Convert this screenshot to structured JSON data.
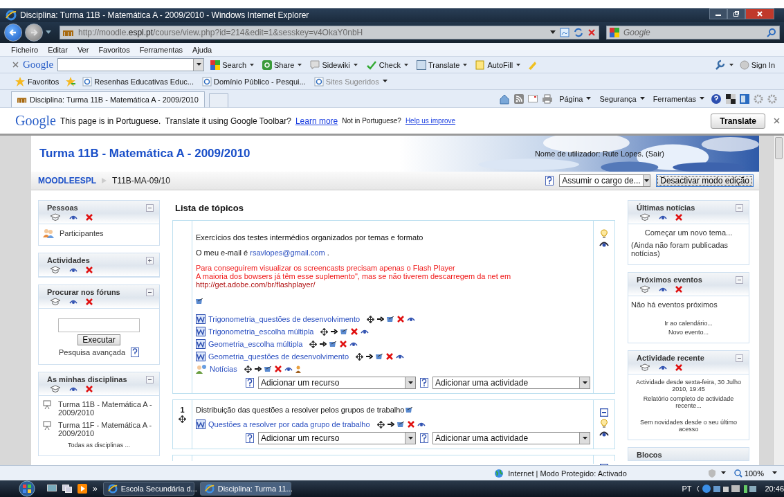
{
  "window": {
    "title": "Disciplina: Turma 11B - Matemática A - 2009/2010 - Windows Internet Explorer"
  },
  "address_bar": {
    "url_start": "http://moodle.",
    "url_domain": "espl.pt",
    "url_end": "/course/view.php?id=214&edit=1&sesskey=v4OkaY0nbH"
  },
  "search_box": {
    "placeholder": "Google"
  },
  "menu": [
    "Ficheiro",
    "Editar",
    "Ver",
    "Favoritos",
    "Ferramentas",
    "Ajuda"
  ],
  "google_toolbar": {
    "logo": "Google",
    "buttons": [
      {
        "label": "Search",
        "kind": "search"
      },
      {
        "label": "Share",
        "kind": "share"
      },
      {
        "label": "Sidewiki",
        "kind": "sidewiki"
      },
      {
        "label": "Check",
        "kind": "check"
      },
      {
        "label": "Translate",
        "kind": "translate"
      },
      {
        "label": "AutoFill",
        "kind": "autofill"
      }
    ],
    "sign_in": "Sign In"
  },
  "favorites_bar": {
    "favorites": "Favoritos",
    "links": [
      {
        "label": "Resenhas Educativas Educ...",
        "disabled": false
      },
      {
        "label": "Domínio Público - Pesqui...",
        "disabled": false
      },
      {
        "label": "Sites Sugeridos",
        "disabled": true
      }
    ]
  },
  "tabs": [
    {
      "label": "Disciplina: Turma 11B - Matemática A - 2009/2010",
      "selected": true
    }
  ],
  "command_bar": [
    "Página",
    "Segurança",
    "Ferramentas"
  ],
  "translate_bar": {
    "logo": "Google",
    "message": "This page is in Portuguese.  Translate it using Google Toolbar?",
    "learn_more": "Learn more",
    "not_in": "Not in Portuguese?",
    "help": "Help us improve",
    "button": "Translate"
  },
  "page": {
    "course_title": "Turma 11B - Matemática A - 2009/2010",
    "user_info": "Nome de utilizador: Rute Lopes. (Sair)",
    "breadcrumb": [
      "MOODLEESPL",
      "T11B-MA-09/10"
    ],
    "role_select": "Assumir o cargo de...",
    "edit_button": "Desactivar modo edição",
    "heading": "Lista de tópicos"
  },
  "left_blocks": [
    {
      "title": "Pessoas",
      "kind": "links",
      "expanded": true,
      "items": [
        "Participantes"
      ]
    },
    {
      "title": "Actividades",
      "expanded": false
    },
    {
      "title": "Procurar nos fóruns",
      "kind": "search",
      "expanded": true,
      "button": "Executar",
      "link": "Pesquisa avançada"
    },
    {
      "title": "As minhas disciplinas",
      "kind": "courses",
      "expanded": true,
      "items": [
        "Turma 11B - Matemática A - 2009/2010",
        "Turma 11F - Matemática A - 2009/2010"
      ],
      "footer": "Todas as disciplinas ..."
    }
  ],
  "sections": [
    {
      "kind": "intro",
      "paragraphs": [
        {
          "kind": "text",
          "text": "Exercícios dos testes intermédios organizados por temas e formato"
        },
        {
          "kind": "email",
          "text": "O meu e-mail é ",
          "link": "rsavlopes@gmail.com",
          "after": " ."
        },
        {
          "kind": "warning",
          "lines": [
            "Para conseguirem visualizar os screencasts precisam apenas o Flash Player",
            "A maioria dos bowsers já têm esse suplemento\", mas se não tiverem descarregem da net em"
          ],
          "url": "http://get.adobe.com/br/flashplayer/"
        }
      ],
      "resources": [
        {
          "name": "Trigonometria_questões de desenvolvimento",
          "kind": "document"
        },
        {
          "name": "Trigonometria_escolha múltipla",
          "kind": "document"
        },
        {
          "name": "Geometria_escolha múltipla",
          "kind": "document"
        },
        {
          "name": "Geometria_questões de desenvolvimento",
          "kind": "document"
        },
        {
          "name": "Notícias",
          "kind": "forum"
        }
      ],
      "add_resource": "Adicionar um recurso",
      "add_activity": "Adicionar uma actividade"
    },
    {
      "number": "1",
      "kind": "topic",
      "title": "Distribuição das questões a resolver pelos grupos de trabalho",
      "resources": [
        {
          "name": "Questões a resolver por cada grupo de trabalho",
          "kind": "document"
        }
      ],
      "add_resource": "Adicionar um recurso",
      "add_activity": "Adicionar uma actividade"
    }
  ],
  "right_blocks": [
    {
      "title": "Últimas notícias",
      "kind": "news",
      "expanded": true,
      "link": "Começar um novo tema...",
      "note": "(Ainda não foram publicadas notícias)"
    },
    {
      "title": "Próximos eventos",
      "kind": "events",
      "expanded": true,
      "message": "Não há eventos próximos",
      "links": [
        "Ir ao calendário...",
        "Novo evento..."
      ]
    },
    {
      "title": "Actividade recente",
      "kind": "recent",
      "expanded": true,
      "since": "Actividade desde sexta-feira, 30 Julho 2010, 19:45",
      "report": "Relatório completo de actividade recente...",
      "none": "Sem novidades desde o seu último acesso"
    },
    {
      "title": "Blocos",
      "kind": "empty"
    }
  ],
  "status_bar": {
    "zone": "Internet | Modo Protegido: Activado",
    "zoom": "100%"
  },
  "taskbar": {
    "more": "»",
    "windows": [
      {
        "label": "Escola Secundária d...",
        "selected": false
      },
      {
        "label": "Disciplina: Turma 11...",
        "selected": true
      }
    ],
    "language": "PT",
    "time": "20:46"
  }
}
